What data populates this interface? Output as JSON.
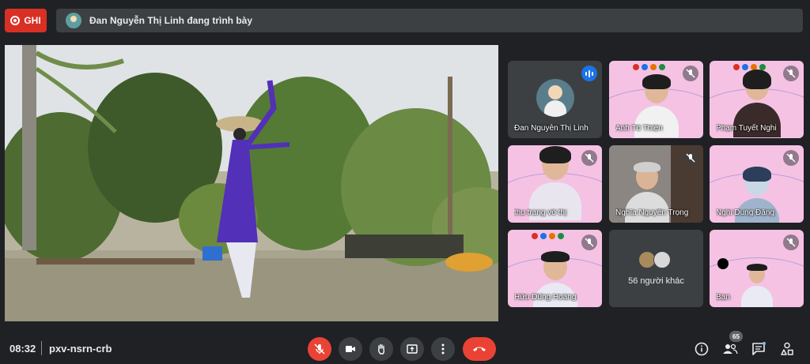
{
  "recording": {
    "label": "GHI"
  },
  "presenter_bar": {
    "text": "Đan Nguyễn Thị Linh đang trình bày"
  },
  "participants": [
    {
      "name": "Đan Nguyễn Thị Linh",
      "state": "speaking"
    },
    {
      "name": "Anh Tô Thiện",
      "state": "muted"
    },
    {
      "name": "Phạm Tuyết Nghi",
      "state": "muted"
    },
    {
      "name": "thu trang võ thị",
      "state": "muted"
    },
    {
      "name": "Nghĩa Nguyễn Trọng",
      "state": "muted"
    },
    {
      "name": "Nghi Dung Đặng",
      "state": "muted"
    },
    {
      "name": "Hữu Dũng Hoàng",
      "state": "muted"
    },
    {
      "name": "Bạn",
      "state": "muted"
    }
  ],
  "others": {
    "label": "56 người khác"
  },
  "bottom_bar": {
    "time": "08:32",
    "meeting_code": "pxv-nsrn-crb",
    "people_count": "65"
  },
  "controls": [
    "mic-off-icon",
    "camera-icon",
    "raise-hand-icon",
    "present-screen-icon",
    "more-options-icon",
    "end-call-icon"
  ],
  "colors": {
    "record_red": "#d93025",
    "end_call_red": "#ea4335",
    "bar_bg": "#3c4043",
    "speaking_blue": "#1a73e8",
    "tile_pink": "#f5c2e4"
  }
}
